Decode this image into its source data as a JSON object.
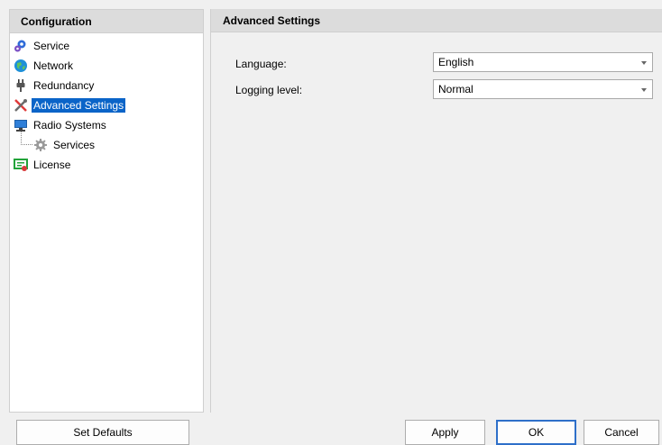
{
  "sidebar": {
    "title": "Configuration",
    "items": [
      {
        "label": "Service",
        "icon": "gear-blue-icon"
      },
      {
        "label": "Network",
        "icon": "globe-icon"
      },
      {
        "label": "Redundancy",
        "icon": "plug-icon"
      },
      {
        "label": "Advanced Settings",
        "icon": "tools-icon",
        "selected": true
      },
      {
        "label": "Radio Systems",
        "icon": "monitor-icon"
      },
      {
        "label": "Services",
        "icon": "gear-gray-icon",
        "child": true
      },
      {
        "label": "License",
        "icon": "license-icon"
      }
    ]
  },
  "main": {
    "title": "Advanced Settings",
    "fields": {
      "language": {
        "label": "Language:",
        "value": "English"
      },
      "logging": {
        "label": "Logging level:",
        "value": "Normal"
      }
    }
  },
  "buttons": {
    "set_defaults": "Set Defaults",
    "apply": "Apply",
    "ok": "OK",
    "cancel": "Cancel"
  },
  "colors": {
    "selection": "#0a64c8",
    "header": "#dcdcdc",
    "default_button_border": "#2e6fc9"
  }
}
